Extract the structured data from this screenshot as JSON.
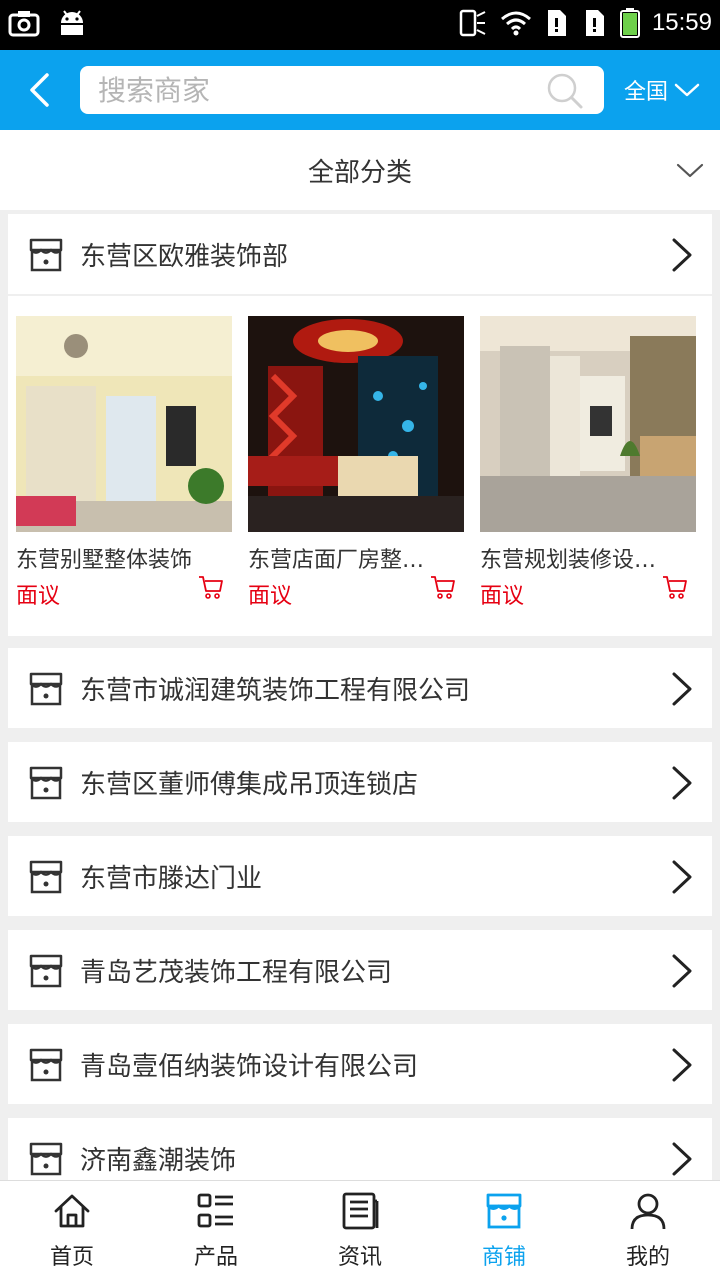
{
  "status_bar": {
    "time": "15:59"
  },
  "header": {
    "search_placeholder": "搜索商家",
    "region": "全国"
  },
  "category": {
    "label": "全部分类"
  },
  "featured_shop": {
    "name": "东营区欧雅装饰部",
    "products": [
      {
        "name": "东营别墅整体装饰",
        "price": "面议"
      },
      {
        "name": "东营店面厂房整…",
        "price": "面议"
      },
      {
        "name": "东营规划装修设…",
        "price": "面议"
      }
    ]
  },
  "shops": [
    {
      "name": "东营市诚润建筑装饰工程有限公司"
    },
    {
      "name": "东营区董师傅集成吊顶连锁店"
    },
    {
      "name": "东营市滕达门业"
    },
    {
      "name": "青岛艺茂装饰工程有限公司"
    },
    {
      "name": "青岛壹佰纳装饰设计有限公司"
    },
    {
      "name": "济南鑫潮装饰"
    }
  ],
  "tabs": [
    {
      "label": "首页",
      "icon": "home-icon"
    },
    {
      "label": "产品",
      "icon": "list-icon"
    },
    {
      "label": "资讯",
      "icon": "news-icon"
    },
    {
      "label": "商铺",
      "icon": "store-icon",
      "active": true
    },
    {
      "label": "我的",
      "icon": "user-icon"
    }
  ],
  "colors": {
    "accent": "#0ba2ee",
    "price": "#e60012"
  }
}
